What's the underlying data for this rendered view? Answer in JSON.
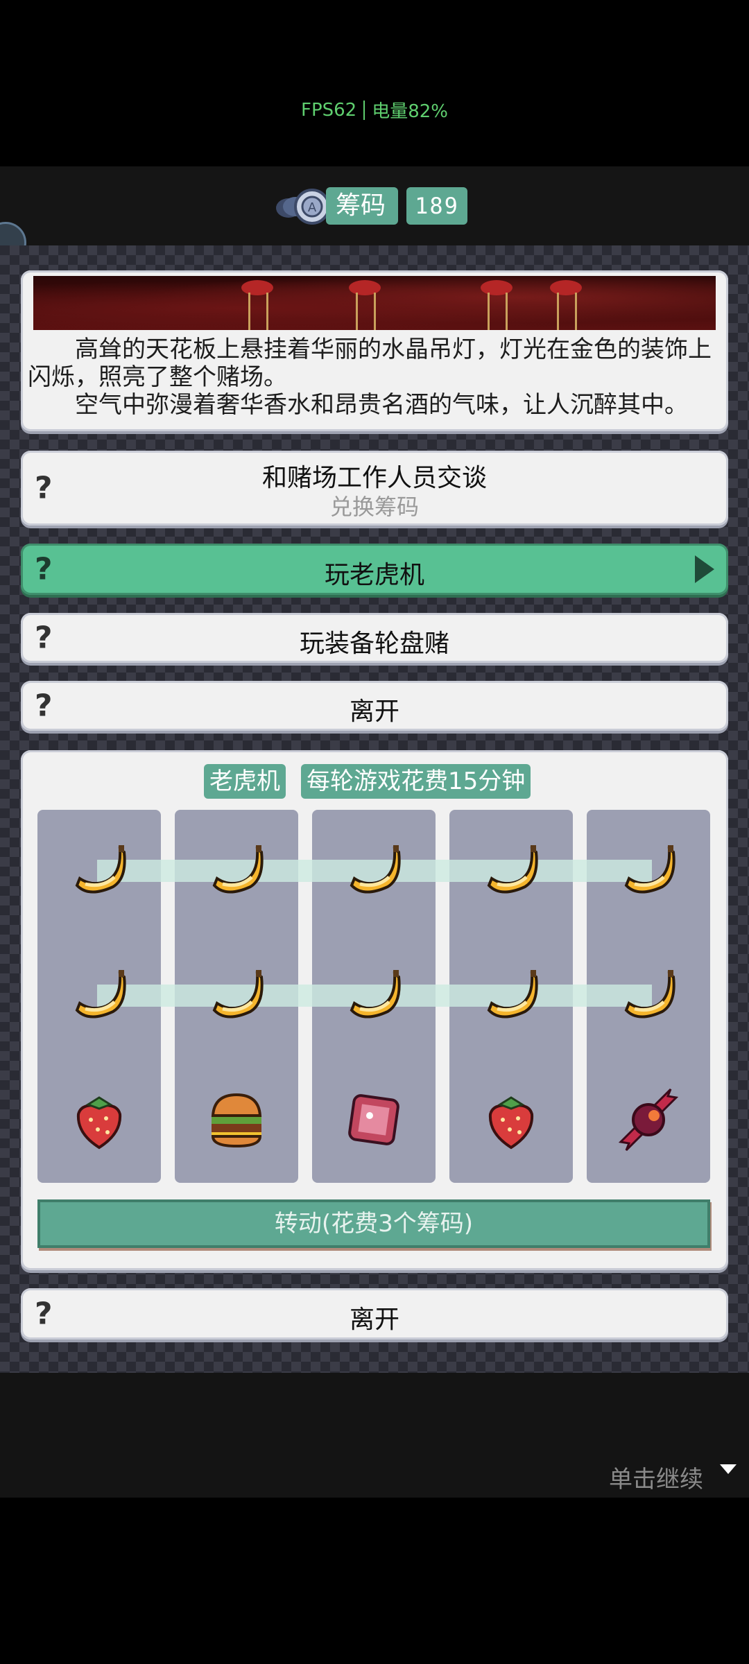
{
  "status": {
    "fps": "FPS62",
    "battery": "电量82%"
  },
  "currency": {
    "label": "筹码",
    "count": "189"
  },
  "story": {
    "para1": "高耸的天花板上悬挂着华丽的水晶吊灯，灯光在金色的装饰上闪烁，照亮了整个赌场。",
    "para2": "空气中弥漫着奢华香水和昂贵名酒的气味，让人沉醉其中。"
  },
  "options": {
    "talk_label": "和赌场工作人员交谈",
    "talk_sub": "兑换筹码",
    "slots_label": "玩老虎机",
    "roulette_label": "玩装备轮盘赌",
    "leave_label": "离开"
  },
  "slot_machine": {
    "title": "老虎机",
    "cost_note": "每轮游戏花费15分钟",
    "reels": [
      [
        "banana-icon",
        "banana-icon",
        "strawberry-icon"
      ],
      [
        "banana-icon",
        "banana-icon",
        "burger-icon"
      ],
      [
        "banana-icon",
        "banana-icon",
        "gem-icon"
      ],
      [
        "banana-icon",
        "banana-icon",
        "strawberry-icon"
      ],
      [
        "banana-icon",
        "banana-icon",
        "candy-icon"
      ]
    ],
    "spin_label": "转动(花费3个筹码)",
    "leave_label": "离开"
  },
  "footer": {
    "continue_label": "单击继续"
  },
  "colors": {
    "accent": "#5ea892",
    "selected": "#58c193",
    "reel_bg": "#9c9fb2"
  }
}
